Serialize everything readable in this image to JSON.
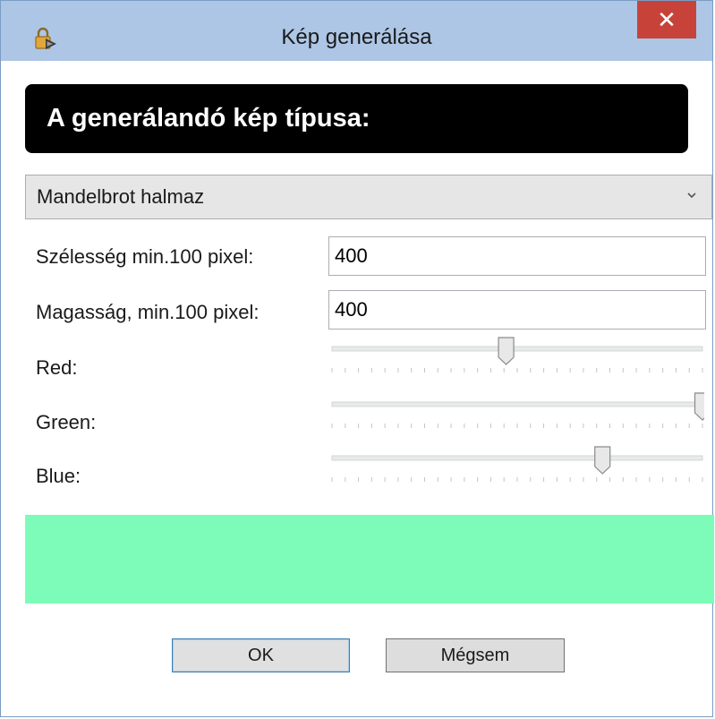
{
  "window": {
    "title": "Kép generálása",
    "close_label": "✕",
    "app_icon": "lock-arrow-icon"
  },
  "header": {
    "text": "A generálandó kép típusa:"
  },
  "image_type": {
    "selected": "Mandelbrot halmaz",
    "chevron_icon": "chevron-down-icon"
  },
  "fields": {
    "width_label": "Szélesség min.100 pixel:",
    "width_value": "400",
    "height_label": "Magasság, min.100 pixel:",
    "height_value": "400"
  },
  "sliders": [
    {
      "label": "Red:",
      "fraction": 0.47
    },
    {
      "label": "Green:",
      "fraction": 1.0
    },
    {
      "label": "Blue:",
      "fraction": 0.73
    }
  ],
  "preview": {
    "color": "#7cfcb8"
  },
  "buttons": {
    "ok_label": "OK",
    "cancel_label": "Mégsem"
  },
  "colors": {
    "titlebar": "#adc6e6",
    "close": "#c7433a",
    "header_bg": "#000000"
  }
}
